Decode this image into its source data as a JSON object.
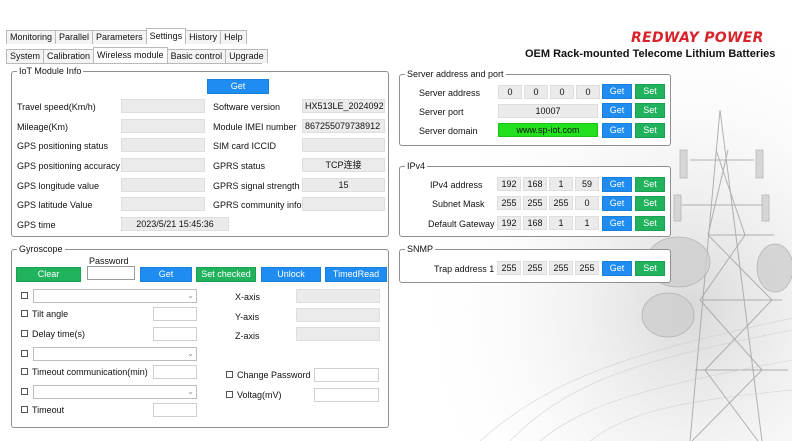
{
  "tabs_row1": [
    "Monitoring",
    "Parallel",
    "Parameters",
    "Settings",
    "History",
    "Help"
  ],
  "tabs_row2": [
    "System",
    "Calibration",
    "Wireless module",
    "Basic control",
    "Upgrade"
  ],
  "brand": {
    "name": "REDWAY POWER",
    "tagline": "OEM Rack-mounted Telecome Lithium Batteries"
  },
  "iot": {
    "legend": "IoT Module Info",
    "get_label": "Get",
    "left_labels": [
      "Travel speed(Km/h)",
      "Mileage(Km)",
      "GPS positioning status",
      "GPS positioning accuracy",
      "GPS longitude value",
      "GPS latitude Value",
      "GPS time"
    ],
    "gps_time": "2023/5/21 15:45:36",
    "right_labels": [
      "Software version",
      "Module IMEI number",
      "SIM card ICCID",
      "GPRS status",
      "GPRS signal strength",
      "GPRS community info"
    ],
    "software_version": "HX513LE_2024092",
    "imei": "867255079738912",
    "gprs_status": "TCP连接",
    "gprs_signal": "15"
  },
  "gyro": {
    "legend": "Gyroscope",
    "password_label": "Password",
    "buttons": {
      "clear": "Clear",
      "get": "Get",
      "set_checked": "Set checked",
      "unlock": "Unlock",
      "timed_read": "TimedRead"
    },
    "tilt_angle": "Tilt angle",
    "delay_time": "Delay time(s)",
    "timeout_comm": "Timeout communication(min)",
    "timeout": "Timeout",
    "x_axis": "X-axis",
    "y_axis": "Y-axis",
    "z_axis": "Z-axis",
    "change_password": "Change Password",
    "voltage": "Voltag(mV)"
  },
  "server": {
    "legend": "Server address and port",
    "address_label": "Server address",
    "address": [
      "0",
      "0",
      "0",
      "0"
    ],
    "port_label": "Server port",
    "port": "10007",
    "domain_label": "Server domain",
    "domain": "www.sp-iot.com",
    "get": "Get",
    "set": "Set",
    "domain_color": "#22e01e"
  },
  "ipv4": {
    "legend": "IPv4",
    "ip_label": "IPv4 address",
    "ip": [
      "192",
      "168",
      "1",
      "59"
    ],
    "mask_label": "Subnet Mask",
    "mask": [
      "255",
      "255",
      "255",
      "0"
    ],
    "gw_label": "Default Gateway",
    "gw": [
      "192",
      "168",
      "1",
      "1"
    ],
    "get": "Get",
    "set": "Set"
  },
  "snmp": {
    "legend": "SNMP",
    "trap_label": "Trap address 1",
    "trap": [
      "255",
      "255",
      "255",
      "255"
    ],
    "get": "Get",
    "set": "Set"
  },
  "colors": {
    "button_blue": "#1e8cf0",
    "button_green": "#20b25c",
    "brand_red": "#d8232a"
  }
}
